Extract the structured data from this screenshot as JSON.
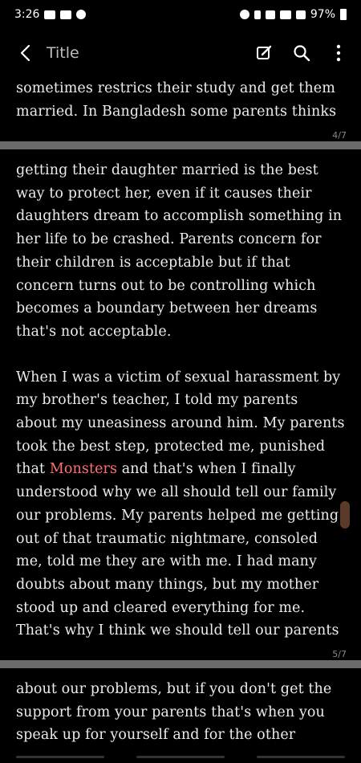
{
  "status": {
    "time": "3:26",
    "battery": "97%"
  },
  "app_bar": {
    "title": "Title"
  },
  "icons": {
    "back": "arrow-left-icon",
    "edit": "edit-icon",
    "search": "search-icon",
    "more": "more-vertical-icon"
  },
  "pages": {
    "page4_tail": [
      "sometimes restrics their study and get them",
      "married. In Bangladesh some parents thinks"
    ],
    "page4_number": "4/7",
    "page5_para1": [
      "getting their daughter married is the best",
      "way to protect her, even if it causes their",
      "daughters dream to accomplish something in",
      "her life to be crashed. Parents concern for",
      "their children is acceptable but if that",
      "concern turns out to be controlling which",
      "becomes a boundary between her dreams",
      "that's not acceptable."
    ],
    "page5_para2": {
      "l1": "When I was a victim of sexual harassment by",
      "l2": "my brother's teacher, I told my parents",
      "l3": "about my uneasiness around him. My parents",
      "l4": "took the best step, protected me, punished",
      "l5_pre": "that ",
      "l5_hl": "Monsters",
      "l5_post": " and that's when I finally",
      "l6": "understood why we all should tell our family",
      "l7": "our problems. My parents helped me getting",
      "l8": "out of that traumatic nightmare, consoled",
      "l9": "me, told me they are with me. I had many",
      "l10": "doubts about many things, but my mother",
      "l11": "stood up and cleared everything for me.",
      "l12": "That's why I think we should tell our parents"
    },
    "page5_number": "5/7",
    "page6_head": [
      "about our problems, but if you don't get the",
      "support from your parents that's when you",
      "speak up for yourself and for the other"
    ]
  }
}
